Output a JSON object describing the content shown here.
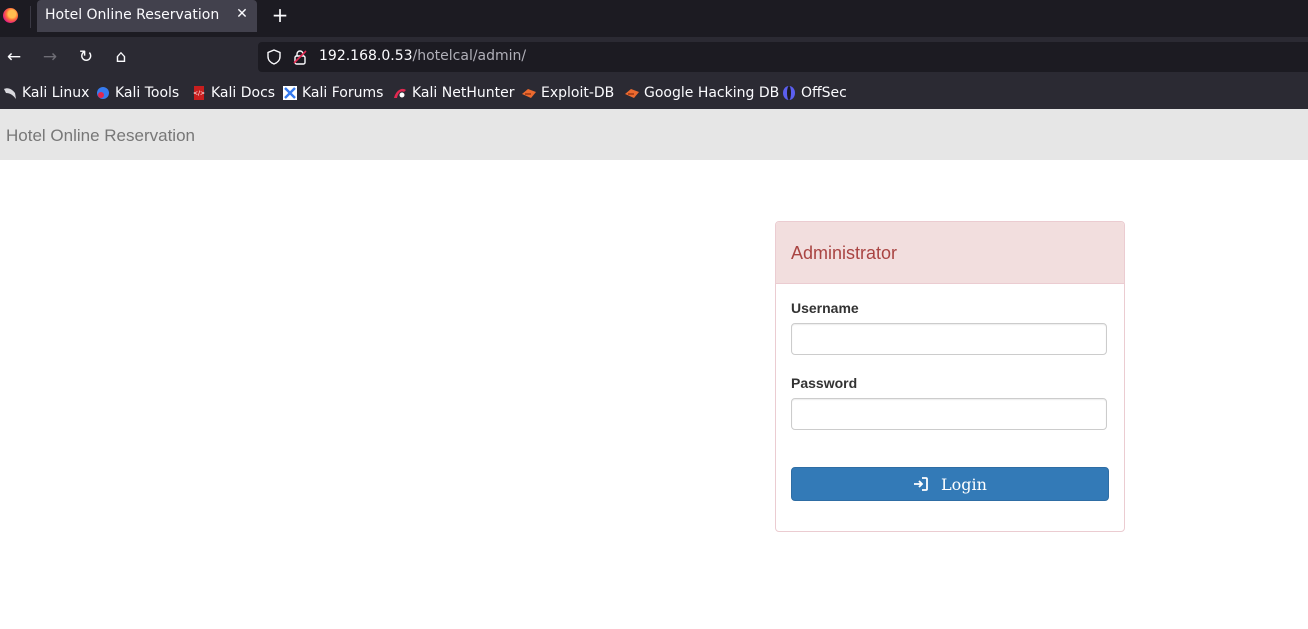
{
  "browser": {
    "tab_title": "Hotel Online Reservation",
    "tab_close": "✕",
    "new_tab": "+",
    "nav": {
      "back": "←",
      "forward": "→",
      "reload": "↻",
      "home": "⌂"
    },
    "url": {
      "host": "192.168.0.53",
      "path": "/hotelcal/admin/"
    },
    "bookmarks": [
      {
        "label": "Kali Linux",
        "icon": "kali-dragon-icon"
      },
      {
        "label": "Kali Tools",
        "icon": "kali-tools-icon"
      },
      {
        "label": "Kali Docs",
        "icon": "kali-docs-icon"
      },
      {
        "label": "Kali Forums",
        "icon": "kali-forums-icon"
      },
      {
        "label": "Kali NetHunter",
        "icon": "nethunter-icon"
      },
      {
        "label": "Exploit-DB",
        "icon": "exploit-db-icon"
      },
      {
        "label": "Google Hacking DB",
        "icon": "ghdb-icon"
      },
      {
        "label": "OffSec",
        "icon": "offsec-icon"
      }
    ]
  },
  "page": {
    "brand": "Hotel Online Reservation",
    "panel": {
      "title": "Administrator",
      "username_label": "Username",
      "username_value": "",
      "password_label": "Password",
      "password_value": "",
      "login_label": "Login"
    }
  },
  "colors": {
    "panel_heading_bg": "#f2dede",
    "panel_title": "#a94442",
    "login_button": "#337ab7"
  }
}
